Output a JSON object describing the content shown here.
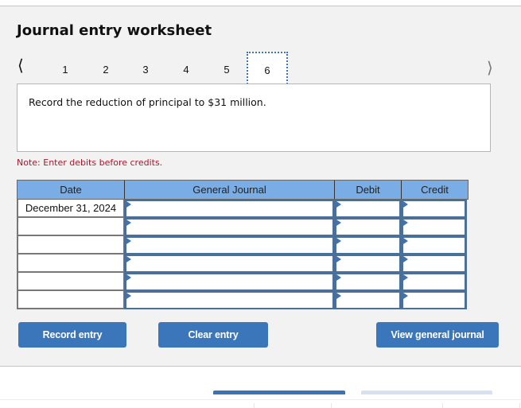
{
  "worksheet": {
    "title": "Journal entry worksheet",
    "nav": {
      "prev_icon": "chevron-left",
      "next_icon": "chevron-right",
      "steps": [
        "1",
        "2",
        "3",
        "4",
        "5",
        "6"
      ],
      "active_step": "6"
    },
    "prompt": "Record the reduction of principal to $31 million.",
    "note": "Note: Enter debits before credits."
  },
  "journal": {
    "headers": {
      "date": "Date",
      "account": "General Journal",
      "debit": "Debit",
      "credit": "Credit"
    },
    "rows": [
      {
        "date": "December 31, 2024",
        "account": "",
        "debit": "",
        "credit": ""
      },
      {
        "date": "",
        "account": "",
        "debit": "",
        "credit": ""
      },
      {
        "date": "",
        "account": "",
        "debit": "",
        "credit": ""
      },
      {
        "date": "",
        "account": "",
        "debit": "",
        "credit": ""
      },
      {
        "date": "",
        "account": "",
        "debit": "",
        "credit": ""
      },
      {
        "date": "",
        "account": "",
        "debit": "",
        "credit": ""
      }
    ]
  },
  "buttons": {
    "record": "Record entry",
    "clear": "Clear entry",
    "view": "View general journal"
  },
  "colors": {
    "accent": "#3b76ba",
    "header_fill": "#7aade5",
    "note_red": "#a31a2e"
  }
}
